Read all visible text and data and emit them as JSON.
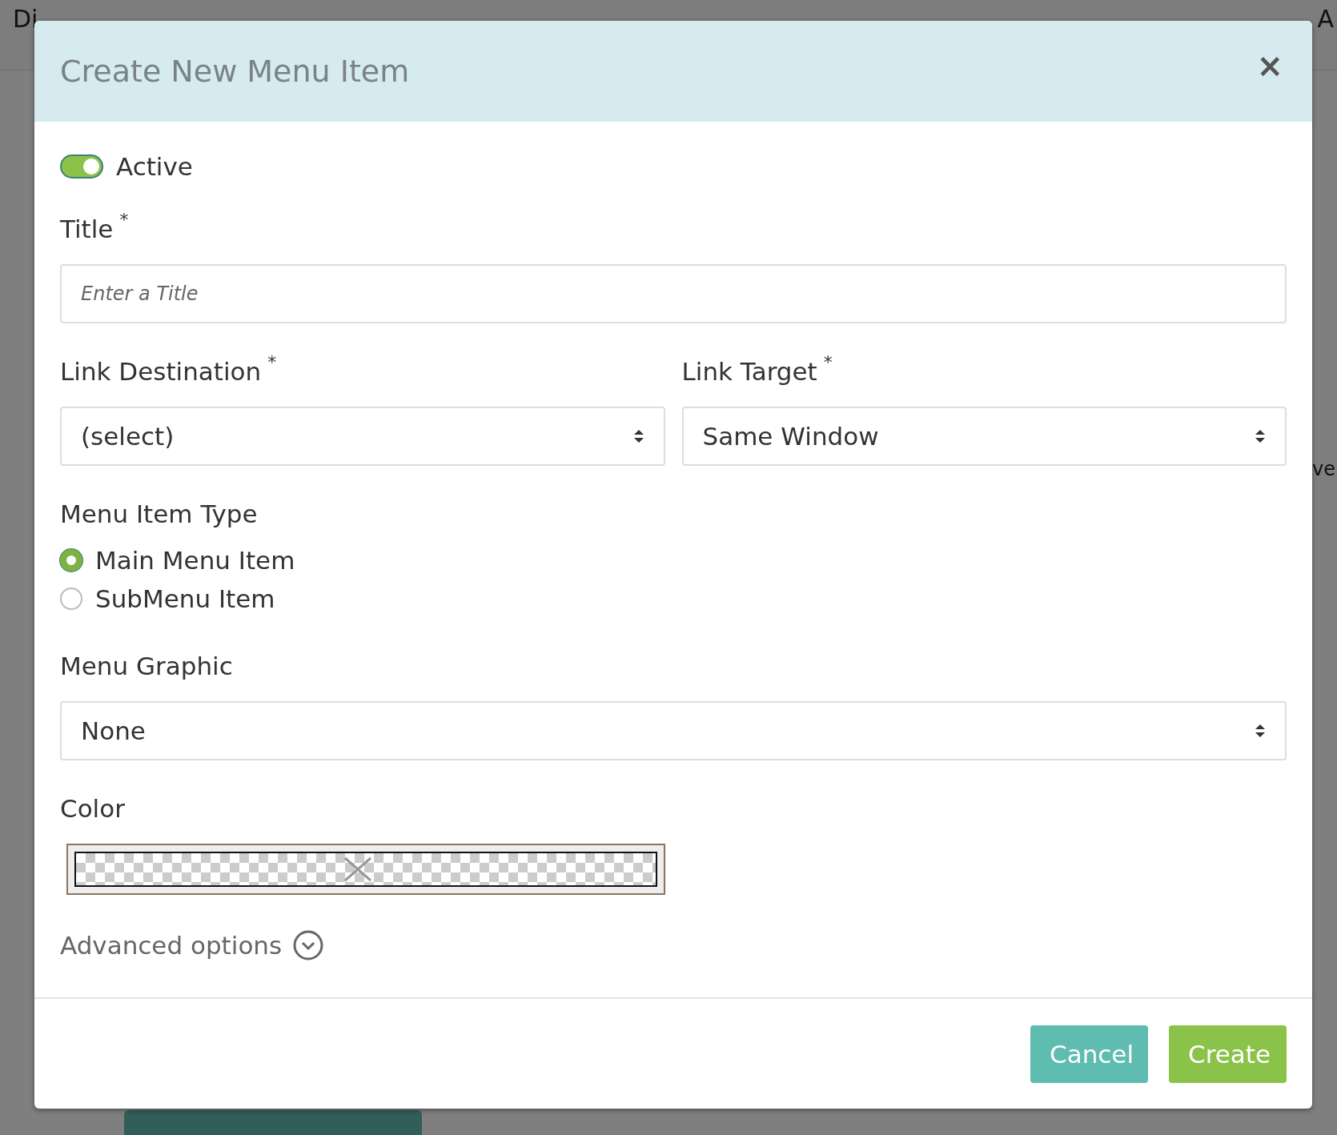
{
  "page": {
    "title": "Di",
    "back_link": "A",
    "side_text": "ve"
  },
  "dialog": {
    "title": "Create New Menu Item",
    "close": "×",
    "active": {
      "label": "Active",
      "on": true
    },
    "title_field": {
      "label": "Title",
      "required_mark": "*",
      "placeholder": "Enter a Title"
    },
    "link_destination": {
      "label": "Link Destination",
      "required_mark": "*",
      "value": "(select)"
    },
    "link_target": {
      "label": "Link Target",
      "required_mark": "*",
      "value": "Same Window"
    },
    "menu_item_type": {
      "label": "Menu Item Type",
      "options": [
        {
          "label": "Main Menu Item",
          "selected": true
        },
        {
          "label": "SubMenu Item",
          "selected": false
        }
      ]
    },
    "menu_graphic": {
      "label": "Menu Graphic",
      "value": "None"
    },
    "color": {
      "label": "Color"
    },
    "advanced": {
      "label": "Advanced options",
      "expanded": false
    },
    "buttons": [
      {
        "label": "Cancel",
        "kind": "secondary"
      },
      {
        "label": "Create",
        "kind": "primary"
      }
    ]
  }
}
